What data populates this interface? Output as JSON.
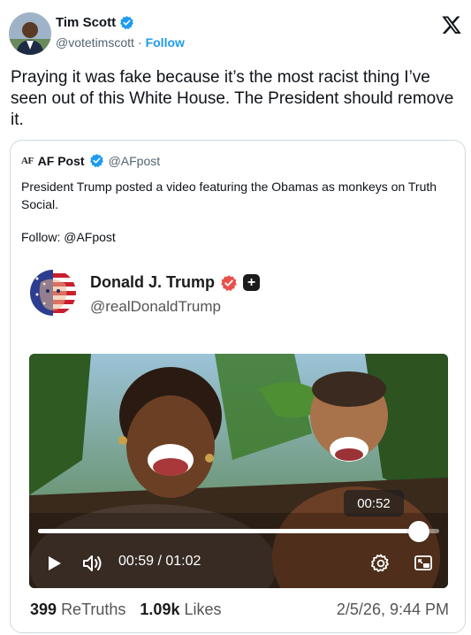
{
  "tweet": {
    "author_name": "Tim Scott",
    "author_handle": "@votetimscott",
    "separator": "·",
    "follow_label": "Follow",
    "text": "Praying it was fake because it’s the most racist thing I’ve seen out of this White House. The President should remove it."
  },
  "quote": {
    "logo_text": "AF",
    "author_name": "AF Post",
    "author_handle": "@AFpost",
    "text": "President Trump posted a video featuring the Obamas as monkeys on Truth Social.",
    "follow_line": "Follow: @AFpost"
  },
  "truth_post": {
    "author_name": "Donald J. Trump",
    "author_handle": "@realDonaldTrump",
    "video": {
      "duration_badge": "00:52",
      "time_display": "00:59 / 01:02",
      "progress_fraction": 0.95
    },
    "stats": {
      "retruths_count": "399",
      "retruths_label": "ReTruths",
      "likes_count": "1.09k",
      "likes_label": "Likes",
      "timestamp": "2/5/26, 9:44 PM"
    }
  },
  "colors": {
    "accent": "#1d9bf0",
    "truth_verified": "#e8504a",
    "border": "#cfd9de",
    "muted": "#536471"
  }
}
